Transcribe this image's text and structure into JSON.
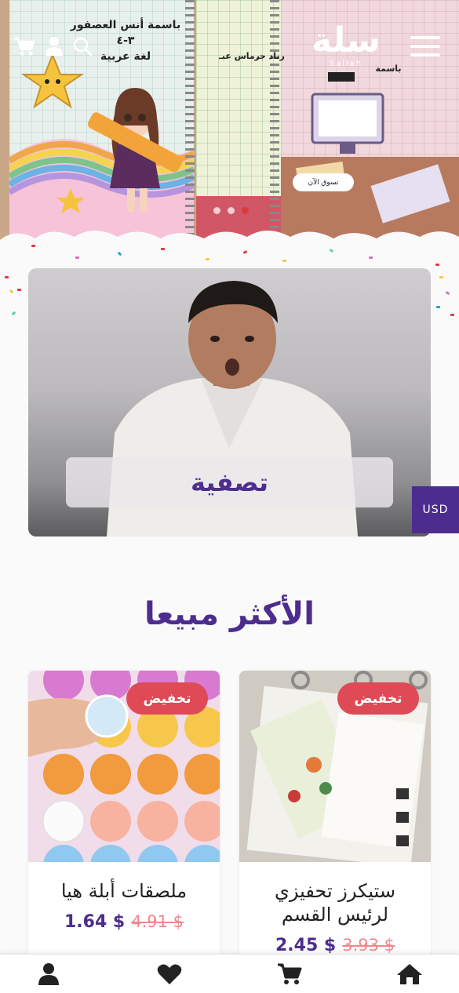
{
  "header": {
    "logo_text": "سلة",
    "logo_subtitle": "Sallah",
    "icons": [
      "menu-icon",
      "search-icon",
      "user-icon",
      "cart-icon"
    ]
  },
  "hero": {
    "cover_left_line1": "باسمة أنس العصفور",
    "cover_left_line2": "٣-٤",
    "cover_left_line3": "لغة عربية",
    "cover_mid_text": "رناد جـ",
    "cover_mid_text2": "رماس عبـ",
    "cover_right_text": "باسمة",
    "shop_button_label": "تسوق الآن",
    "active_slide_color": "#e0373f"
  },
  "banner": {
    "label": "تصفية"
  },
  "currency": {
    "label": "USD"
  },
  "best_sellers": {
    "title": "الأكثر مبيعا",
    "products": [
      {
        "title_line1": "ستيكرز تحفيزي",
        "title_line2": "لرئيس القسم",
        "badge": "تخفيض",
        "old_price": "3.93 $",
        "new_price": "2.45 $"
      },
      {
        "title_line1": "ملصقات أبلة هيا",
        "badge": "تخفيض",
        "old_price": "4.91 $",
        "new_price": "1.64 $"
      }
    ]
  },
  "bottom_nav": {
    "items": [
      "home-icon",
      "cart-icon",
      "heart-icon",
      "user-icon"
    ]
  },
  "colors": {
    "brand": "#4c2d8e",
    "sale": "#de4a55",
    "old_price": "#f3868d"
  }
}
